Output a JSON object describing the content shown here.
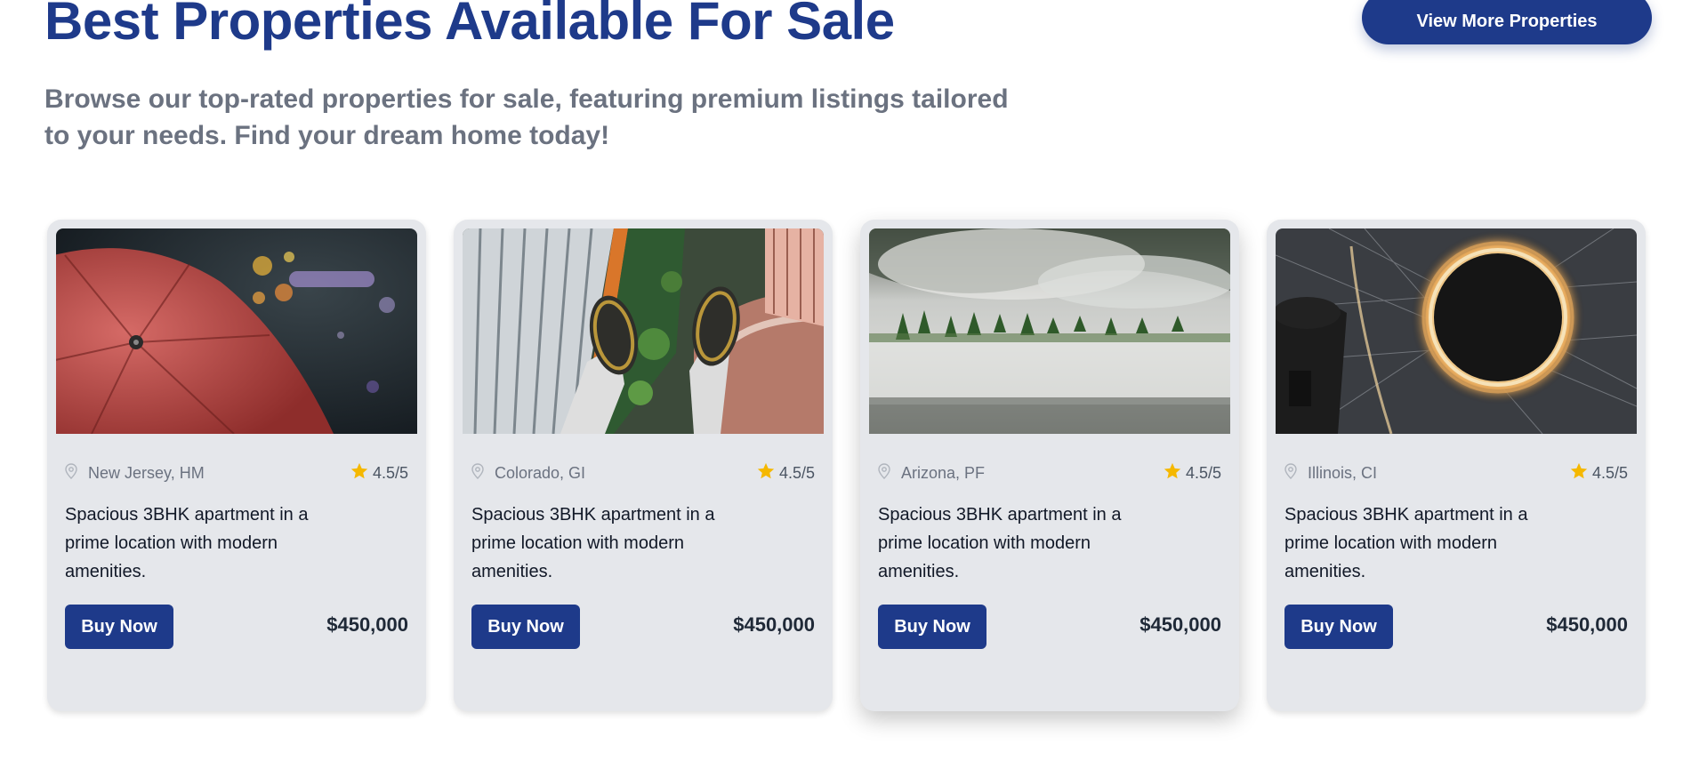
{
  "section": {
    "title": "Best Properties Available For Sale",
    "subtitle": "Browse our top-rated properties for sale, featuring premium listings tailored to your needs. Find your dream home today!",
    "view_more_label": "View More Properties"
  },
  "colors": {
    "brand": "#1e3a8a",
    "card_bg": "#e5e7eb",
    "star": "#f5b800",
    "muted_text": "#6b7280"
  },
  "icons": {
    "location": "map-pin-icon",
    "rating": "star-icon"
  },
  "properties": [
    {
      "image": "red-umbrella-photo",
      "location": "New Jersey, HM",
      "rating": "4.5/5",
      "description": "Spacious 3BHK apartment in a prime location with modern amenities.",
      "buy_label": "Buy Now",
      "price": "$450,000"
    },
    {
      "image": "feet-over-skyscrapers-photo",
      "location": "Colorado, GI",
      "rating": "4.5/5",
      "description": "Spacious 3BHK apartment in a prime location with modern amenities.",
      "buy_label": "Buy Now",
      "price": "$450,000"
    },
    {
      "image": "misty-forest-photo",
      "location": "Arizona, PF",
      "rating": "4.5/5",
      "description": "Spacious 3BHK apartment in a prime location with modern amenities.",
      "buy_label": "Buy Now",
      "price": "$450,000"
    },
    {
      "image": "light-tunnel-photo",
      "location": "Illinois, CI",
      "rating": "4.5/5",
      "description": "Spacious 3BHK apartment in a prime location with modern amenities.",
      "buy_label": "Buy Now",
      "price": "$450,000"
    }
  ]
}
